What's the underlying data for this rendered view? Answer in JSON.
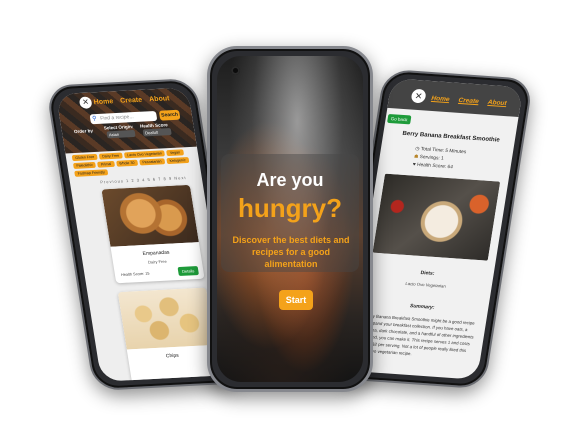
{
  "left_phone": {
    "nav": [
      "Home",
      "Create",
      "About"
    ],
    "search": {
      "placeholder": "Find a recipe...",
      "button": "Search"
    },
    "filters": {
      "order_label": "Order by",
      "origin_label": "Select Origin:",
      "origin_value": "Asian",
      "health_label": "Health Score",
      "health_value": "Deafult"
    },
    "tags": [
      "Gluten Free",
      "Dairy Free",
      "Lacto Ovo Vegetarian",
      "Vegan",
      "Paleolithic",
      "Primal",
      "Whole 30",
      "Pescatarian",
      "Ketogenic",
      "Fodmap Friendly"
    ],
    "pager": "Previous 1 2 3 4 5 6 7 8 9 Next",
    "cards": [
      {
        "title": "Empanadas",
        "sub": "Dairy Free",
        "health": "Health Score: 15",
        "button": "Details"
      },
      {
        "title": "Chips",
        "sub": "",
        "health": "",
        "button": ""
      }
    ]
  },
  "center_phone": {
    "line1": "Are you",
    "line2": "hungry?",
    "description": "Discover the best diets and recipes for a good alimentation",
    "start_button": "Start"
  },
  "right_phone": {
    "nav": [
      "Home",
      "Create",
      "About"
    ],
    "back_button": "Go back",
    "title": "Berry Banana Breakfast Smoothie",
    "info": [
      "Total Time: 5 Minutes",
      "Servings: 1",
      "Health Score: 64"
    ],
    "info_icons": [
      "clock-icon",
      "servings-icon",
      "heart-icon"
    ],
    "diets_heading": "Diets:",
    "diets": "Lacto Ovo Vegetarian",
    "summary_heading": "Summary:",
    "summary": "Berry Banana Breakfast Smoothie might be a good recipe to expand your breakfast collection. If you have oats, a banana, dark chocolate, and a handful of other ingredients on hand, you can make it. This recipe serves 1 and costs about $2 per serving. Not a lot of people really liked this lacto ovo vegetarian recipe."
  },
  "colors": {
    "accent": "#f4a21a",
    "green": "#1e9b3a",
    "dark": "#2b2c30"
  }
}
